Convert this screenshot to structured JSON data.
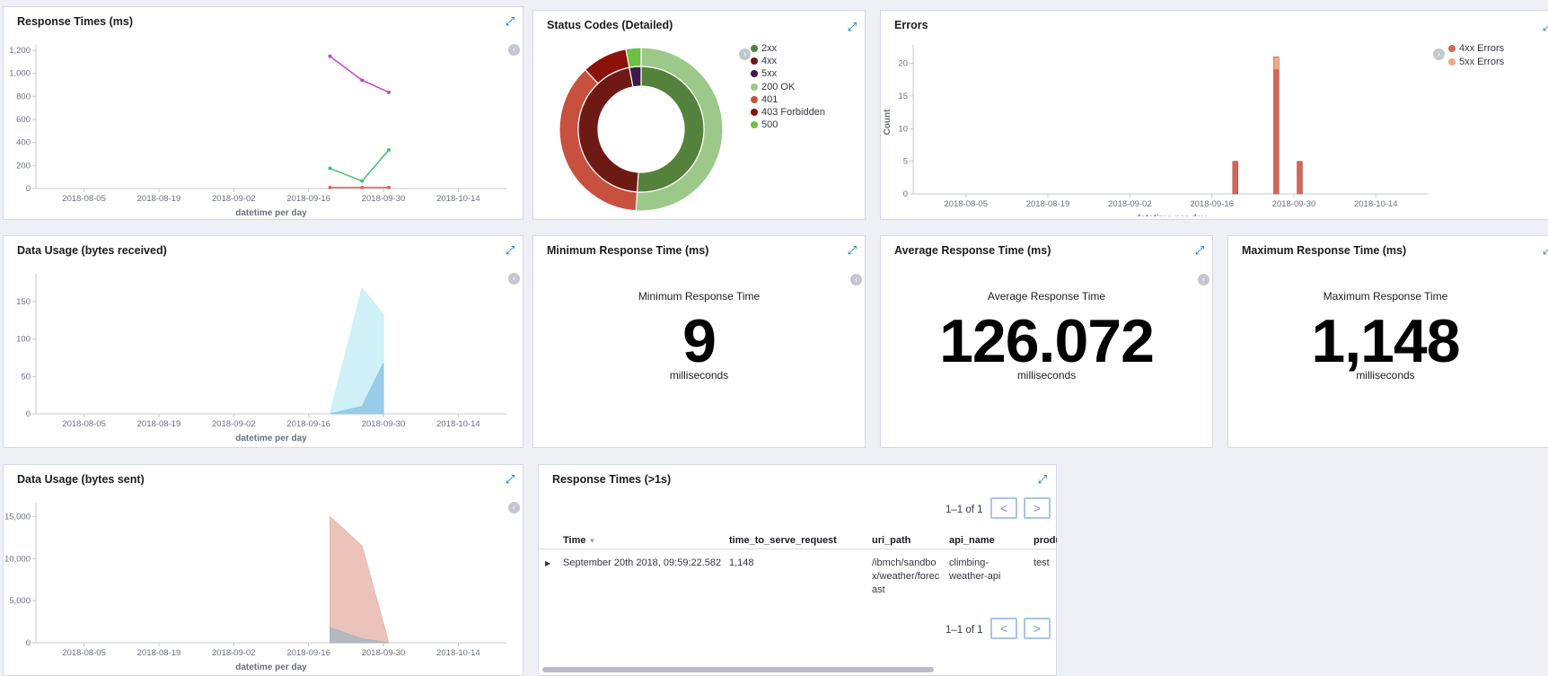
{
  "colors": {
    "accent": "#006bb4",
    "line_purple": "#c045cc",
    "line_green": "#3cc46b",
    "line_red": "#e7664c",
    "area_light_blue": "#c8eef7",
    "area_dark_blue": "#8fc6e6",
    "area_salmon": "#e8b8ae",
    "area_grey": "#a9b7bd"
  },
  "icons": {
    "expand": "expand-icon",
    "legend_toggle": "chevron-left-icon"
  },
  "panels": {
    "response_times": {
      "title": "Response Times (ms)"
    },
    "status_codes": {
      "title": "Status Codes (Detailed)"
    },
    "errors": {
      "title": "Errors"
    },
    "data_received": {
      "title": "Data Usage (bytes received)"
    },
    "min_response": {
      "title": "Minimum Response Time (ms)",
      "label": "Minimum Response Time",
      "value": "9",
      "unit": "milliseconds"
    },
    "avg_response": {
      "title": "Average Response Time (ms)",
      "label": "Average Response Time",
      "value": "126.072",
      "unit": "milliseconds"
    },
    "max_response": {
      "title": "Maximum Response Time (ms)",
      "label": "Maximum Response Time",
      "value": "1,148",
      "unit": "milliseconds"
    },
    "data_sent": {
      "title": "Data Usage (bytes sent)"
    },
    "slow_table": {
      "title": "Response Times (>1s)",
      "pagination": "1–1 of 1",
      "columns": [
        "Time",
        "time_to_serve_request",
        "uri_path",
        "api_name",
        "produ"
      ],
      "rows": [
        {
          "time": "September 20th 2018, 09:59:22.582",
          "time_to_serve_request": "1,148",
          "uri_path": "/ibmch/sandbox/weather/forecast",
          "api_name": "climbing-weather-api",
          "product": "test"
        }
      ]
    }
  },
  "chart_data": [
    {
      "type": "line",
      "title": "Response Times (ms)",
      "xlabel": "datetime per day",
      "ylabel": "",
      "x_ticks": [
        "2018-08-05",
        "2018-08-19",
        "2018-09-02",
        "2018-09-16",
        "2018-09-30",
        "2018-10-14"
      ],
      "y_ticks": [
        "0",
        "200",
        "400",
        "600",
        "800",
        "1,000",
        "1,200"
      ],
      "xlim": [
        "2018-07-27",
        "2018-10-23"
      ],
      "ylim": [
        0,
        1200
      ],
      "series": [
        {
          "color": "#c045cc",
          "x": [
            "2018-09-20",
            "2018-09-26",
            "2018-10-01"
          ],
          "y": [
            1148,
            940,
            835
          ]
        },
        {
          "color": "#3cc46b",
          "x": [
            "2018-09-20",
            "2018-09-26",
            "2018-10-01"
          ],
          "y": [
            175,
            65,
            335
          ]
        },
        {
          "color": "#e7664c",
          "x": [
            "2018-09-20",
            "2018-09-26",
            "2018-10-01"
          ],
          "y": [
            9,
            9,
            9
          ]
        }
      ]
    },
    {
      "type": "pie",
      "title": "Status Codes (Detailed)",
      "legend": [
        "2xx",
        "4xx",
        "5xx",
        "200 OK",
        "401",
        "403 Forbidden",
        "500"
      ],
      "legend_colors": [
        "#54823c",
        "#6e1a14",
        "#3d1a47",
        "#9cc98a",
        "#c7503f",
        "#8a1208",
        "#6cc042"
      ],
      "inner_ring": [
        {
          "label": "2xx",
          "value": 51,
          "color": "#54823c"
        },
        {
          "label": "4xx",
          "value": 46,
          "color": "#6e1a14"
        },
        {
          "label": "5xx",
          "value": 3,
          "color": "#3d1a47"
        }
      ],
      "outer_ring": [
        {
          "label": "200 OK",
          "value": 51,
          "color": "#9cc98a"
        },
        {
          "label": "401",
          "value": 37,
          "color": "#c7503f"
        },
        {
          "label": "403 Forbidden",
          "value": 9,
          "color": "#8a1208"
        },
        {
          "label": "500",
          "value": 3,
          "color": "#6cc042"
        }
      ]
    },
    {
      "type": "bar",
      "title": "Errors",
      "stacked": true,
      "xlabel": "datetime per day",
      "ylabel": "Count",
      "x_ticks": [
        "2018-08-05",
        "2018-08-19",
        "2018-09-02",
        "2018-09-16",
        "2018-09-30",
        "2018-10-14"
      ],
      "y_ticks": [
        "0",
        "5",
        "10",
        "15",
        "20"
      ],
      "xlim": [
        "2018-07-27",
        "2018-10-23"
      ],
      "ylim": [
        0,
        22
      ],
      "categories": [
        "2018-09-20",
        "2018-09-27",
        "2018-10-01"
      ],
      "series": [
        {
          "name": "4xx Errors",
          "color": "#d36757",
          "values": [
            5,
            19,
            5
          ]
        },
        {
          "name": "5xx Errors",
          "color": "#f4a97b",
          "values": [
            0,
            2,
            0
          ]
        }
      ]
    },
    {
      "type": "area",
      "title": "Data Usage (bytes received)",
      "xlabel": "datetime per day",
      "ylabel": "",
      "x_ticks": [
        "2018-08-05",
        "2018-08-19",
        "2018-09-02",
        "2018-09-16",
        "2018-09-30",
        "2018-10-14"
      ],
      "y_ticks": [
        "0",
        "50",
        "100",
        "150"
      ],
      "xlim": [
        "2018-07-27",
        "2018-10-23"
      ],
      "ylim": [
        0,
        180
      ],
      "series": [
        {
          "color": "#c8eef7",
          "x": [
            "2018-09-20",
            "2018-09-26",
            "2018-09-30"
          ],
          "y": [
            0,
            168,
            133
          ]
        },
        {
          "color": "#8fc6e6",
          "x": [
            "2018-09-20",
            "2018-09-26",
            "2018-09-30"
          ],
          "y": [
            0,
            10,
            68
          ]
        }
      ]
    },
    {
      "type": "area",
      "title": "Data Usage (bytes sent)",
      "xlabel": "datetime per day",
      "ylabel": "",
      "x_ticks": [
        "2018-08-05",
        "2018-08-19",
        "2018-09-02",
        "2018-09-16",
        "2018-09-30",
        "2018-10-14"
      ],
      "y_ticks": [
        "0",
        "5,000",
        "10,000",
        "15,000"
      ],
      "xlim": [
        "2018-07-27",
        "2018-10-23"
      ],
      "ylim": [
        0,
        16000
      ],
      "series": [
        {
          "color": "#e8b8ae",
          "x": [
            "2018-09-20",
            "2018-09-26",
            "2018-10-01"
          ],
          "y": [
            15000,
            11500,
            0
          ]
        },
        {
          "color": "#a9b7bd",
          "x": [
            "2018-09-20",
            "2018-09-26",
            "2018-10-01"
          ],
          "y": [
            1800,
            500,
            0
          ]
        }
      ]
    }
  ]
}
